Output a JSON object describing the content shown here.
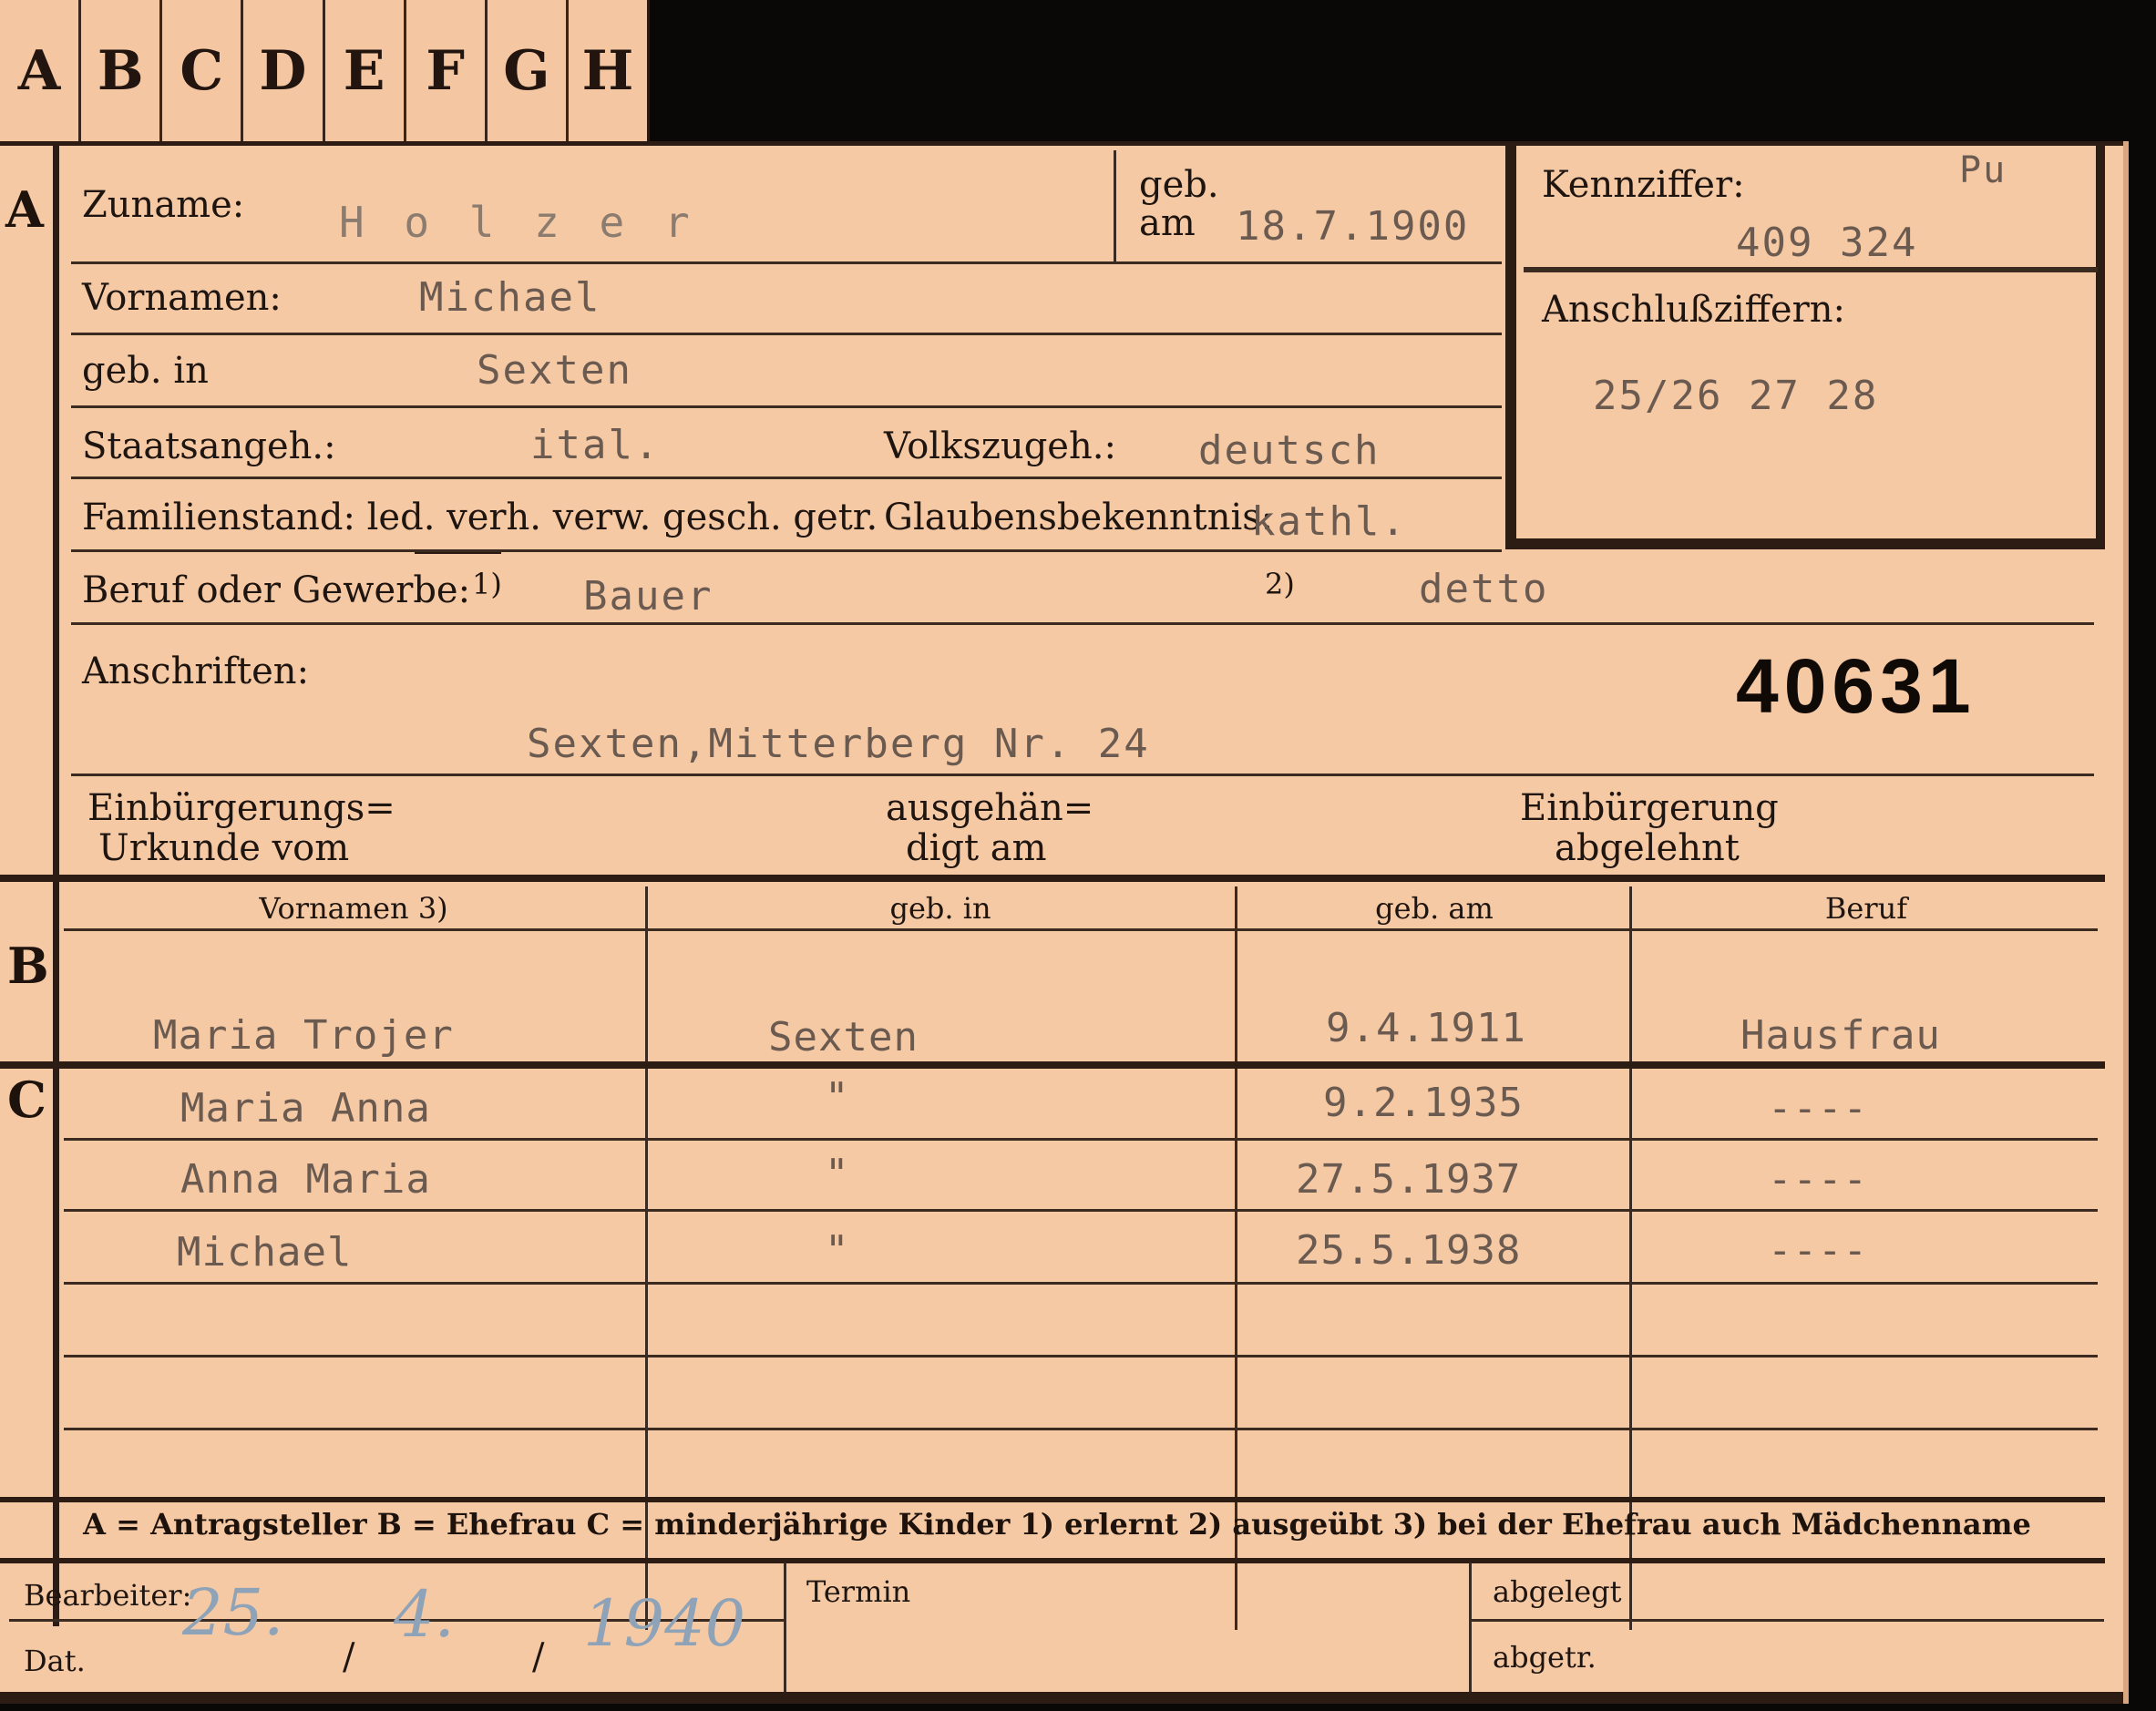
{
  "tabs": [
    "A",
    "B",
    "C",
    "D",
    "E",
    "F",
    "G",
    "H"
  ],
  "sections": {
    "a": "A",
    "b": "B",
    "c": "C"
  },
  "header": {
    "zuname_label": "Zuname:",
    "zuname": "H o l z e r",
    "geb_label": "geb.",
    "am_label": "am",
    "geb_am": "18.7.1900",
    "kennziffer_label": "Kennziffer:",
    "kennziffer_mark": "Pu",
    "kennziffer": "409 324",
    "anschluss_label": "Anschlußziffern:",
    "anschluss": "25/26 27 28"
  },
  "person": {
    "vornamen_label": "Vornamen:",
    "vornamen": "Michael",
    "geb_in_label": "geb. in",
    "geb_in": "Sexten",
    "staatsangeh_label": "Staatsangeh.:",
    "staatsangeh": "ital.",
    "volkszugeh_label": "Volkszugeh.:",
    "volkszugeh": "deutsch",
    "familienstand_label": "Familienstand: led. verh. verw. gesch. getr.",
    "glaubens_label": "Glaubensbekenntnis:",
    "glaubens": "kathl.",
    "beruf_label": "Beruf oder Gewerbe:",
    "beruf_note1": "1)",
    "beruf": "Bauer",
    "beruf_note2": "2)",
    "beruf2": "detto",
    "anschriften_label": "Anschriften:",
    "anschrift": "Sexten,Mitterberg Nr. 24",
    "file_number": "40631",
    "einb_label_1": "Einbürgerungs=",
    "einb_label_2": "Urkunde vom",
    "ausgeh_label_1": "ausgehän=",
    "ausgeh_label_2": "digt am",
    "abgelehnt_label_1": "Einbürgerung",
    "abgelehnt_label_2": "abgelehnt"
  },
  "table": {
    "headers": [
      "Vornamen 3)",
      "geb. in",
      "geb. am",
      "Beruf"
    ],
    "spouse": {
      "name": "Maria Trojer",
      "place": "Sexten",
      "date": "9.4.1911",
      "job": "Hausfrau"
    },
    "children": [
      {
        "name": "Maria Anna",
        "place": "\"",
        "date": "9.2.1935",
        "job": "----"
      },
      {
        "name": "Anna Maria",
        "place": "\"",
        "date": "27.5.1937",
        "job": "----"
      },
      {
        "name": "Michael",
        "place": "\"",
        "date": "25.5.1938",
        "job": "----"
      }
    ]
  },
  "legend": "A = Antragsteller   B = Ehefrau   C = minderjährige Kinder   1) erlernt   2) ausgeübt   3) bei der Ehefrau auch Mädchenname",
  "footer": {
    "bearbeiter_label": "Bearbeiter:",
    "dat_label": "Dat.",
    "date_day": "25.",
    "date_month": "4.",
    "date_year": "1940",
    "sep": "/",
    "termin_label": "Termin",
    "abgelegt_label": "abgelegt",
    "abgetr_label": "abgetr."
  }
}
